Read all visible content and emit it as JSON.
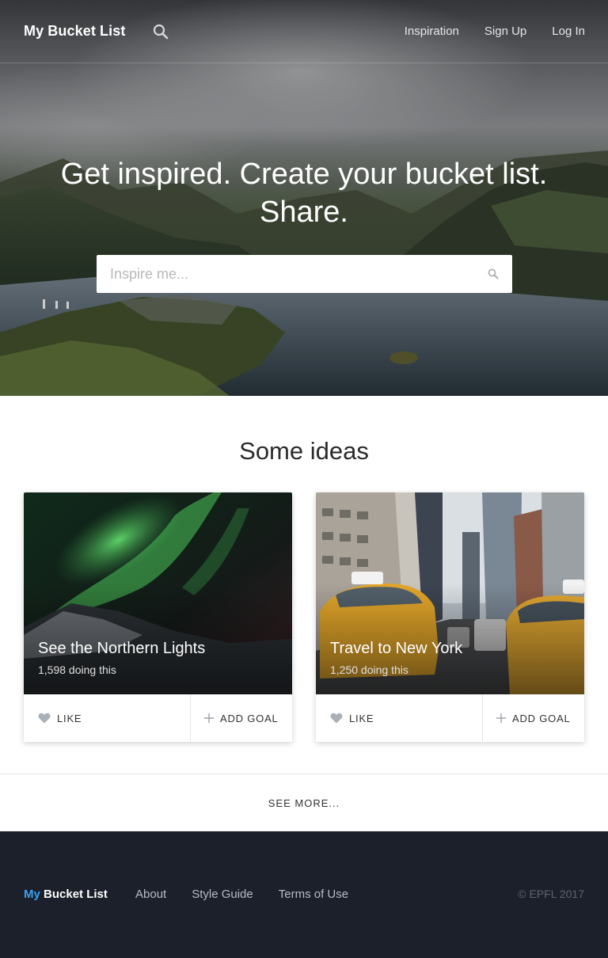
{
  "nav": {
    "brand": "My Bucket List",
    "links": [
      "Inspiration",
      "Sign Up",
      "Log In"
    ]
  },
  "hero": {
    "headline_line1": "Get inspired. Create your bucket list.",
    "headline_line2": "Share.",
    "search_placeholder": "Inspire me..."
  },
  "ideas": {
    "title": "Some ideas",
    "cards": [
      {
        "title": "See the Northern Lights",
        "count": "1,598 doing this",
        "like_label": "LIKE",
        "add_label": "ADD GOAL"
      },
      {
        "title": "Travel to New York",
        "count": "1,250 doing this",
        "like_label": "LIKE",
        "add_label": "ADD GOAL"
      }
    ],
    "see_more": "SEE MORE..."
  },
  "footer": {
    "brand_my": "My",
    "brand_rest": "Bucket List",
    "links": [
      "About",
      "Style Guide",
      "Terms of Use"
    ],
    "copyright": "© EPFL 2017"
  },
  "colors": {
    "footer_bg": "#1b202a",
    "footer_accent": "#3b9ff0",
    "icon_grey": "#aab0b8"
  },
  "icons": [
    "search-icon",
    "heart-icon",
    "plus-icon"
  ]
}
